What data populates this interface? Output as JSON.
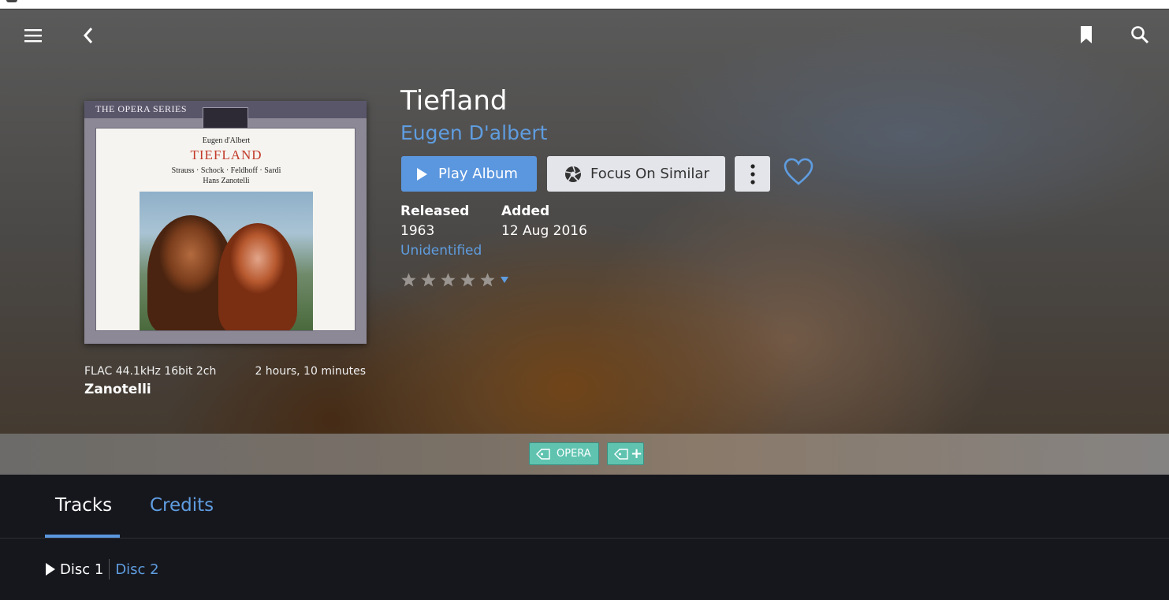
{
  "header": {
    "menu_icon": "hamburger-menu-icon",
    "back_icon": "chevron-left-icon",
    "bookmark_icon": "bookmark-icon",
    "search_icon": "search-icon"
  },
  "album": {
    "title": "Tiefland",
    "artist": "Eugen D'albert",
    "cover": {
      "series": "THE OPERA SERIES",
      "logo": "eurodisc",
      "composer": "Eugen d'Albert",
      "title": "TIEFLAND",
      "cast": "Strauss · Schock · Feldhoff · Sardi",
      "conductor": "Hans Zanotelli"
    },
    "format": "FLAC 44.1kHz 16bit 2ch",
    "duration": "2 hours, 10 minutes",
    "conductor": "Zanotelli"
  },
  "actions": {
    "play_label": "Play Album",
    "focus_label": "Focus On Similar",
    "more_icon": "vertical-dots-icon",
    "favorite_icon": "heart-outline-icon"
  },
  "meta": {
    "released_label": "Released",
    "released_value": "1963",
    "added_label": "Added",
    "added_value": "12 Aug 2016",
    "status_link": "Unidentified"
  },
  "rating": {
    "value": 0,
    "max": 5,
    "dropdown_icon": "caret-down-icon"
  },
  "tags": {
    "items": [
      "OPERA"
    ],
    "add_icon": "tag-add-icon"
  },
  "tabs": {
    "items": [
      {
        "label": "Tracks",
        "active": true
      },
      {
        "label": "Credits",
        "active": false
      }
    ]
  },
  "discs": {
    "items": [
      {
        "label": "Disc 1",
        "active": true
      },
      {
        "label": "Disc 2",
        "active": false
      }
    ]
  },
  "colors": {
    "accent": "#5b97df",
    "link": "#5f9de0",
    "tag": "#5fc3b0",
    "background": "#16171d"
  }
}
